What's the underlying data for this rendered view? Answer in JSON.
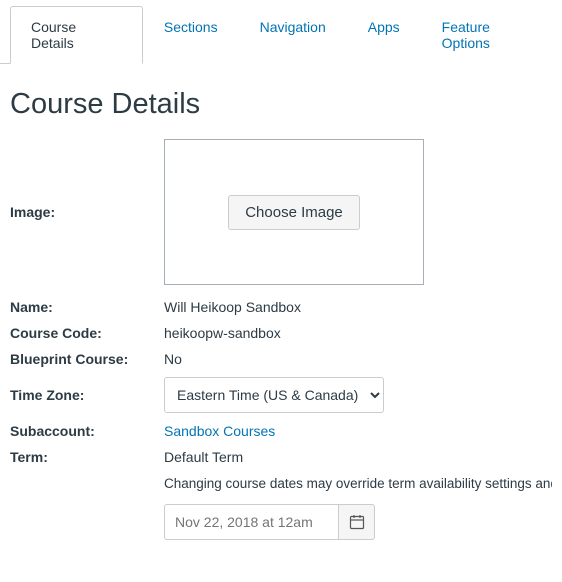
{
  "tabs": {
    "course_details": "Course Details",
    "sections": "Sections",
    "navigation": "Navigation",
    "apps": "Apps",
    "feature_options": "Feature Options"
  },
  "page_title": "Course Details",
  "labels": {
    "image": "Image:",
    "name": "Name:",
    "course_code": "Course Code:",
    "blueprint": "Blueprint Course:",
    "time_zone": "Time Zone:",
    "subaccount": "Subaccount:",
    "term": "Term:"
  },
  "values": {
    "choose_image": "Choose Image",
    "name": "Will Heikoop Sandbox",
    "course_code": "heikoopw-sandbox",
    "blueprint": "No",
    "time_zone": "Eastern Time (US & Canada) (",
    "subaccount": "Sandbox Courses",
    "term": "Default Term",
    "note": "Changing course dates may override term availability settings and placement in the Courses page and Dashboard. Please confirm term dates before modifying course dates.",
    "date_placeholder": "Nov 22, 2018 at 12am"
  }
}
